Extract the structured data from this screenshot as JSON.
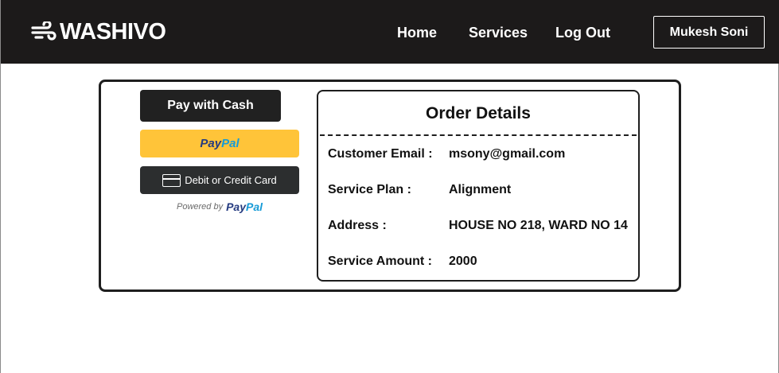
{
  "brand": {
    "name": "WASHIVO",
    "icon": "wind-icon"
  },
  "nav": {
    "links": [
      {
        "label": "Home"
      },
      {
        "label": "Services"
      },
      {
        "label": "Log Out"
      }
    ],
    "user_name": "Mukesh Soni"
  },
  "payment": {
    "cash_label": "Pay with Cash",
    "paypal_label_dark": "Pay",
    "paypal_label_light": "Pal",
    "card_label": "Debit or Credit Card",
    "card_icon": "credit-card-icon",
    "powered_by": "Powered by",
    "paypal_dark": "Pay",
    "paypal_light": "Pal",
    "colors": {
      "paypal_yellow": "#ffc439",
      "paypal_navy": "#253b80",
      "paypal_blue": "#179bd7",
      "card_dark": "#2c2e2f"
    }
  },
  "order": {
    "title": "Order Details",
    "rows": [
      {
        "label": "Customer Email :",
        "value": "msony@gmail.com"
      },
      {
        "label": "Service Plan :",
        "value": "Alignment"
      },
      {
        "label": "Address :",
        "value": "HOUSE NO 218, WARD NO 14"
      },
      {
        "label": "Service Amount :",
        "value": "2000"
      }
    ]
  },
  "colors": {
    "navbar": "#1c1a1a",
    "text": "#111111"
  }
}
